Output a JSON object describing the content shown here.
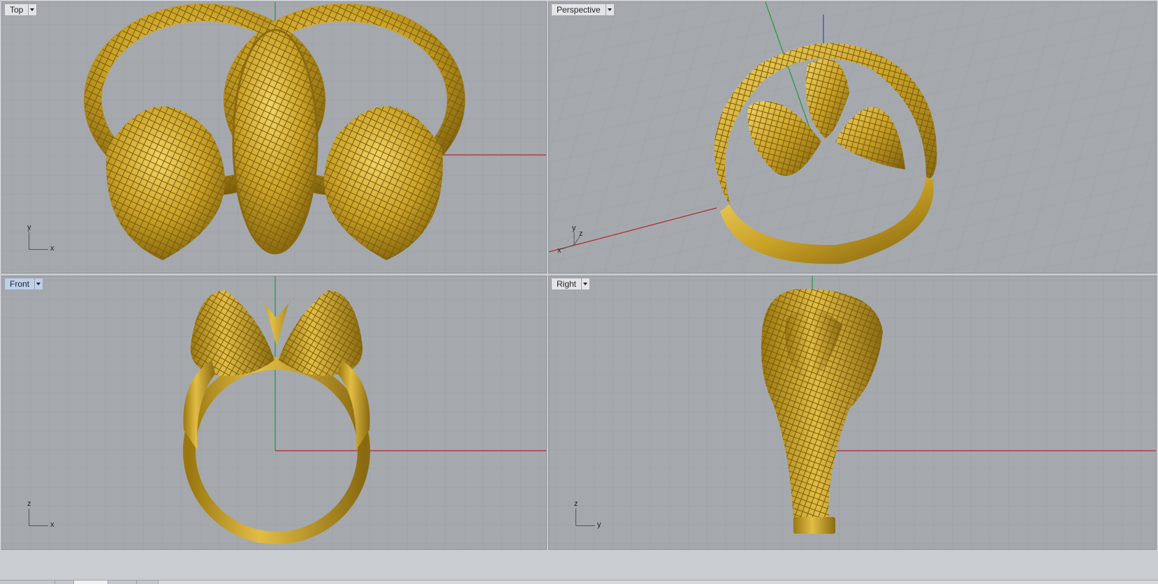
{
  "window": {
    "title": ""
  },
  "viewports": [
    {
      "id": "top",
      "label": "Top",
      "active": false,
      "axis_vertical": "y",
      "axis_horizontal": "x"
    },
    {
      "id": "perspective",
      "label": "Perspective",
      "active": false,
      "axis_labels": [
        "y",
        "z",
        "x"
      ]
    },
    {
      "id": "front",
      "label": "Front",
      "active": true,
      "axis_vertical": "z",
      "axis_horizontal": "x"
    },
    {
      "id": "right",
      "label": "Right",
      "active": false,
      "axis_vertical": "z",
      "axis_horizontal": "y"
    }
  ],
  "colors": {
    "viewport_bg": "#a5a9ae",
    "grid_minor": "#9a9ea3",
    "grid_major": "#8c9095",
    "x_axis": "#b0242b",
    "y_axis": "#1f9a3a",
    "z_axis": "#3441c8",
    "model_gold": "#c9a126",
    "model_gold_dark": "#8a6a10",
    "model_gold_light": "#f0d060"
  },
  "icons": {
    "dropdown": "chevron-down-icon",
    "axis_widget": "axis-indicator-icon"
  },
  "bottom_tabs": {
    "count": 5,
    "active_index": 2
  }
}
